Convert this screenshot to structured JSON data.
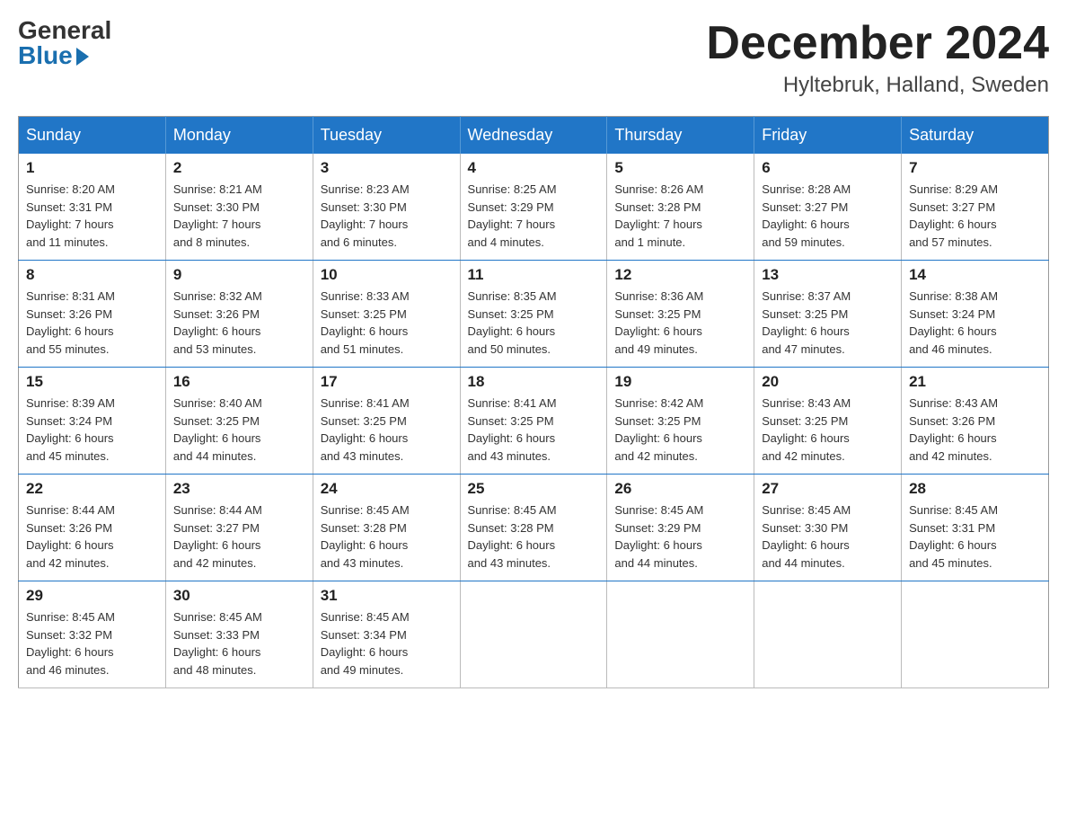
{
  "header": {
    "logo": {
      "general": "General",
      "blue": "Blue"
    },
    "title": "December 2024",
    "location": "Hyltebruk, Halland, Sweden"
  },
  "calendar": {
    "days_of_week": [
      "Sunday",
      "Monday",
      "Tuesday",
      "Wednesday",
      "Thursday",
      "Friday",
      "Saturday"
    ],
    "weeks": [
      [
        {
          "day": "1",
          "info": "Sunrise: 8:20 AM\nSunset: 3:31 PM\nDaylight: 7 hours\nand 11 minutes."
        },
        {
          "day": "2",
          "info": "Sunrise: 8:21 AM\nSunset: 3:30 PM\nDaylight: 7 hours\nand 8 minutes."
        },
        {
          "day": "3",
          "info": "Sunrise: 8:23 AM\nSunset: 3:30 PM\nDaylight: 7 hours\nand 6 minutes."
        },
        {
          "day": "4",
          "info": "Sunrise: 8:25 AM\nSunset: 3:29 PM\nDaylight: 7 hours\nand 4 minutes."
        },
        {
          "day": "5",
          "info": "Sunrise: 8:26 AM\nSunset: 3:28 PM\nDaylight: 7 hours\nand 1 minute."
        },
        {
          "day": "6",
          "info": "Sunrise: 8:28 AM\nSunset: 3:27 PM\nDaylight: 6 hours\nand 59 minutes."
        },
        {
          "day": "7",
          "info": "Sunrise: 8:29 AM\nSunset: 3:27 PM\nDaylight: 6 hours\nand 57 minutes."
        }
      ],
      [
        {
          "day": "8",
          "info": "Sunrise: 8:31 AM\nSunset: 3:26 PM\nDaylight: 6 hours\nand 55 minutes."
        },
        {
          "day": "9",
          "info": "Sunrise: 8:32 AM\nSunset: 3:26 PM\nDaylight: 6 hours\nand 53 minutes."
        },
        {
          "day": "10",
          "info": "Sunrise: 8:33 AM\nSunset: 3:25 PM\nDaylight: 6 hours\nand 51 minutes."
        },
        {
          "day": "11",
          "info": "Sunrise: 8:35 AM\nSunset: 3:25 PM\nDaylight: 6 hours\nand 50 minutes."
        },
        {
          "day": "12",
          "info": "Sunrise: 8:36 AM\nSunset: 3:25 PM\nDaylight: 6 hours\nand 49 minutes."
        },
        {
          "day": "13",
          "info": "Sunrise: 8:37 AM\nSunset: 3:25 PM\nDaylight: 6 hours\nand 47 minutes."
        },
        {
          "day": "14",
          "info": "Sunrise: 8:38 AM\nSunset: 3:24 PM\nDaylight: 6 hours\nand 46 minutes."
        }
      ],
      [
        {
          "day": "15",
          "info": "Sunrise: 8:39 AM\nSunset: 3:24 PM\nDaylight: 6 hours\nand 45 minutes."
        },
        {
          "day": "16",
          "info": "Sunrise: 8:40 AM\nSunset: 3:25 PM\nDaylight: 6 hours\nand 44 minutes."
        },
        {
          "day": "17",
          "info": "Sunrise: 8:41 AM\nSunset: 3:25 PM\nDaylight: 6 hours\nand 43 minutes."
        },
        {
          "day": "18",
          "info": "Sunrise: 8:41 AM\nSunset: 3:25 PM\nDaylight: 6 hours\nand 43 minutes."
        },
        {
          "day": "19",
          "info": "Sunrise: 8:42 AM\nSunset: 3:25 PM\nDaylight: 6 hours\nand 42 minutes."
        },
        {
          "day": "20",
          "info": "Sunrise: 8:43 AM\nSunset: 3:25 PM\nDaylight: 6 hours\nand 42 minutes."
        },
        {
          "day": "21",
          "info": "Sunrise: 8:43 AM\nSunset: 3:26 PM\nDaylight: 6 hours\nand 42 minutes."
        }
      ],
      [
        {
          "day": "22",
          "info": "Sunrise: 8:44 AM\nSunset: 3:26 PM\nDaylight: 6 hours\nand 42 minutes."
        },
        {
          "day": "23",
          "info": "Sunrise: 8:44 AM\nSunset: 3:27 PM\nDaylight: 6 hours\nand 42 minutes."
        },
        {
          "day": "24",
          "info": "Sunrise: 8:45 AM\nSunset: 3:28 PM\nDaylight: 6 hours\nand 43 minutes."
        },
        {
          "day": "25",
          "info": "Sunrise: 8:45 AM\nSunset: 3:28 PM\nDaylight: 6 hours\nand 43 minutes."
        },
        {
          "day": "26",
          "info": "Sunrise: 8:45 AM\nSunset: 3:29 PM\nDaylight: 6 hours\nand 44 minutes."
        },
        {
          "day": "27",
          "info": "Sunrise: 8:45 AM\nSunset: 3:30 PM\nDaylight: 6 hours\nand 44 minutes."
        },
        {
          "day": "28",
          "info": "Sunrise: 8:45 AM\nSunset: 3:31 PM\nDaylight: 6 hours\nand 45 minutes."
        }
      ],
      [
        {
          "day": "29",
          "info": "Sunrise: 8:45 AM\nSunset: 3:32 PM\nDaylight: 6 hours\nand 46 minutes."
        },
        {
          "day": "30",
          "info": "Sunrise: 8:45 AM\nSunset: 3:33 PM\nDaylight: 6 hours\nand 48 minutes."
        },
        {
          "day": "31",
          "info": "Sunrise: 8:45 AM\nSunset: 3:34 PM\nDaylight: 6 hours\nand 49 minutes."
        },
        {
          "day": "",
          "info": ""
        },
        {
          "day": "",
          "info": ""
        },
        {
          "day": "",
          "info": ""
        },
        {
          "day": "",
          "info": ""
        }
      ]
    ]
  }
}
